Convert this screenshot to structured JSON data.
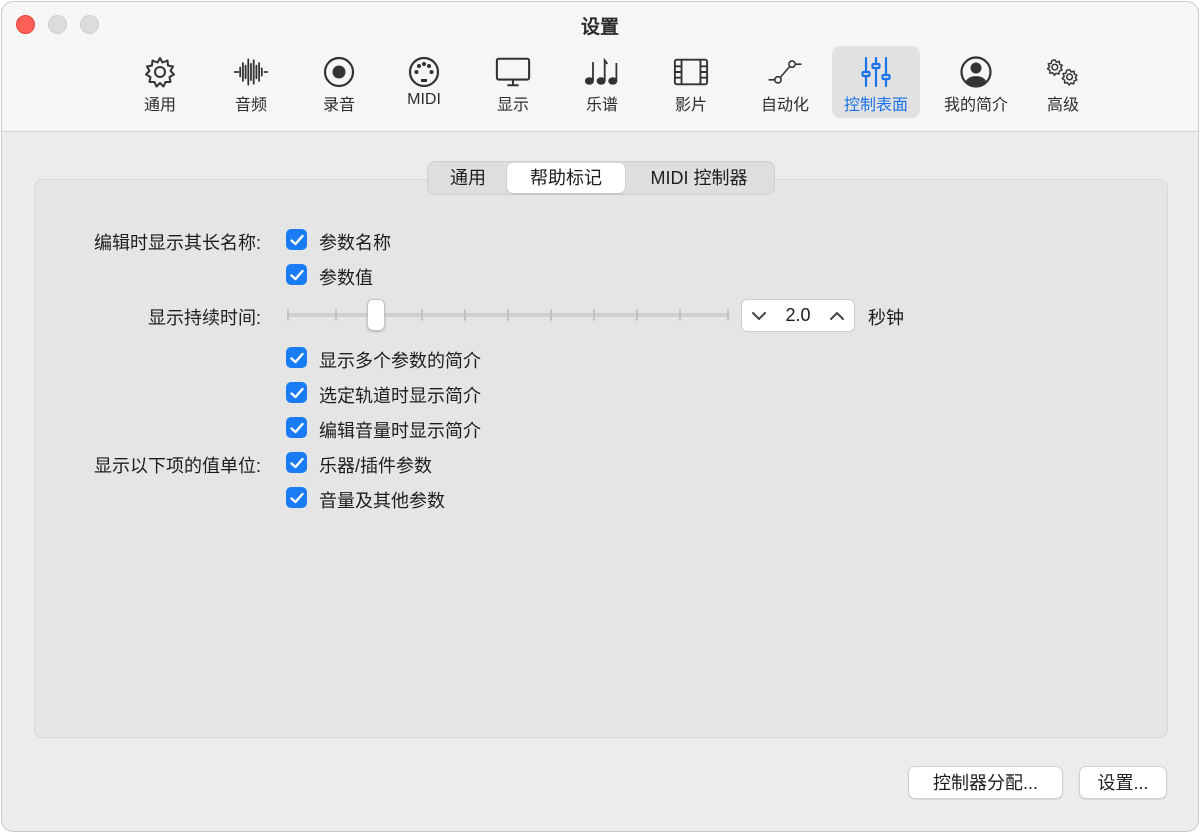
{
  "window": {
    "title": "设置"
  },
  "toolbar": {
    "items": [
      {
        "label": "通用",
        "icon": "gear-icon"
      },
      {
        "label": "音频",
        "icon": "waveform-icon"
      },
      {
        "label": "录音",
        "icon": "record-icon"
      },
      {
        "label": "MIDI",
        "icon": "midi-port-icon"
      },
      {
        "label": "显示",
        "icon": "monitor-icon"
      },
      {
        "label": "乐谱",
        "icon": "music-notes-icon"
      },
      {
        "label": "影片",
        "icon": "film-icon"
      },
      {
        "label": "自动化",
        "icon": "automation-icon"
      },
      {
        "label": "控制表面",
        "icon": "sliders-icon",
        "active": true
      },
      {
        "label": "我的简介",
        "icon": "person-icon"
      },
      {
        "label": "高级",
        "icon": "gears-icon"
      }
    ]
  },
  "tabs": [
    {
      "label": "通用"
    },
    {
      "label": "帮助标记",
      "active": true
    },
    {
      "label": "MIDI 控制器"
    }
  ],
  "content": {
    "long_name_label": "编辑时显示其长名称:",
    "param_name": "参数名称",
    "param_value": "参数值",
    "duration_label": "显示持续时间:",
    "duration_value": "2.0",
    "duration_unit": "秒钟",
    "slider_fraction": 0.2,
    "multi_params": "显示多个参数的简介",
    "track_select": "选定轨道时显示简介",
    "volume_edit": "编辑音量时显示简介",
    "units_label": "显示以下项的值单位:",
    "instrument_params": "乐器/插件参数",
    "volume_params": "音量及其他参数"
  },
  "buttons": {
    "assign": "控制器分配...",
    "settings": "设置..."
  },
  "colors": {
    "accent": "#1a7cf5",
    "active_label": "#1a73e8",
    "close": "#ff5f57"
  }
}
